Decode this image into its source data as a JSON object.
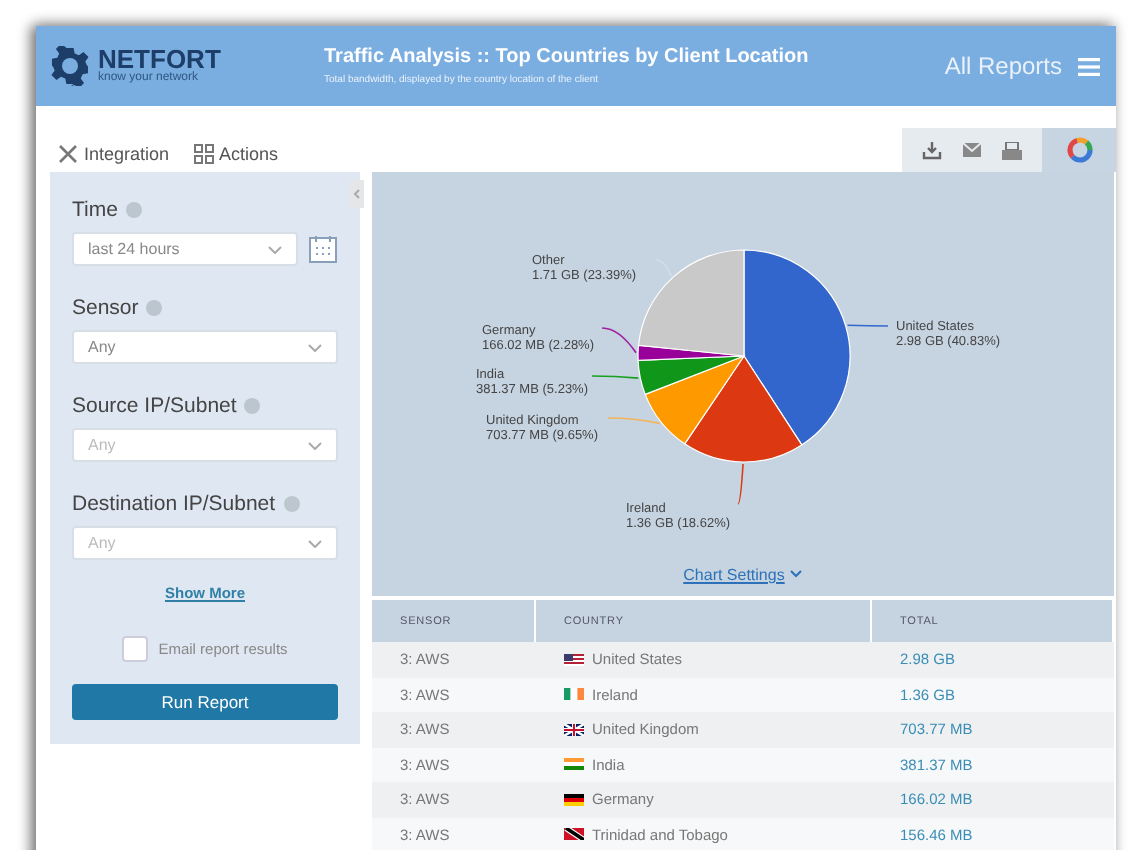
{
  "header": {
    "logo_name": "NETFORT",
    "logo_tagline": "know your network",
    "title": "Traffic Analysis :: Top Countries by Client Location",
    "subtitle": "Total bandwidth, displayed by the country location of the client",
    "menu_label": "All Reports"
  },
  "toolbar": {
    "items": [
      "Integration",
      "Actions"
    ]
  },
  "filters": [
    {
      "label": "Time",
      "value": "last 24 hours",
      "calendar": true
    },
    {
      "label": "Sensor",
      "value": "Any",
      "calendar": false
    },
    {
      "label": "Source IP/Subnet",
      "placeholder": "Any",
      "calendar": false
    },
    {
      "label": "Destination IP/Subnet",
      "placeholder": "Any",
      "calendar": false
    }
  ],
  "show_more": "Show More",
  "email_option": {
    "label": "Email report results",
    "checked": false
  },
  "run_button": "Run Report",
  "chart": {
    "chart_data": {
      "type": "pie",
      "categories": [
        "United States",
        "Ireland",
        "United Kingdom",
        "India",
        "Germany",
        "Other"
      ],
      "values": [
        40.83,
        18.62,
        9.65,
        5.23,
        2.28,
        23.39
      ],
      "data_labels": true,
      "value_labels": [
        "2.98 GB (40.83%)",
        "1.36 GB (18.62%)",
        "703.77 MB (9.65%)",
        "381.37 MB (5.23%)",
        "166.02 MB (2.28%)",
        "1.71 GB (23.39%)"
      ]
    },
    "settings_link": "Chart Settings"
  },
  "table": {
    "columns": [
      "SENSOR",
      "COUNTRY",
      "TOTAL"
    ],
    "rows": [
      {
        "sensor": "3: AWS",
        "country": "United States",
        "total": "2.98 GB"
      },
      {
        "sensor": "3: AWS",
        "country": "Ireland",
        "total": "1.36 GB"
      },
      {
        "sensor": "3: AWS",
        "country": "United Kingdom",
        "total": "703.77 MB"
      },
      {
        "sensor": "3: AWS",
        "country": "India",
        "total": "381.37 MB"
      },
      {
        "sensor": "3: AWS",
        "country": "Germany",
        "total": "166.02 MB"
      },
      {
        "sensor": "3: AWS",
        "country": "Trinidad and Tobago",
        "total": "156.46 MB"
      }
    ]
  }
}
